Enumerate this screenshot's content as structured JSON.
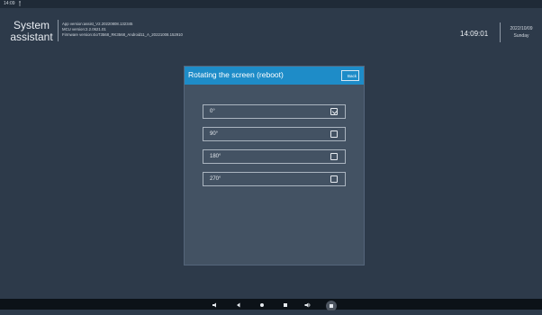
{
  "status_bar": {
    "time": "14:09",
    "signal": "⁈"
  },
  "header": {
    "app_title_line1": "System",
    "app_title_line2": "assistant",
    "app_version": "App version:assist_V2.20220808.132345",
    "mcu_version": "MCU version:2.2.0621.01",
    "firmware_version": "Firmware version:4ioT3568_RK3568_Android11_A_20221008.152910",
    "clock": "14:09:01",
    "date": "2022/10/09",
    "weekday": "Sunday"
  },
  "dialog": {
    "title": "Rotating the screen (reboot)",
    "back_label": "Back",
    "options": [
      {
        "label": "0°",
        "checked": true
      },
      {
        "label": "90°",
        "checked": false
      },
      {
        "label": "180°",
        "checked": false
      },
      {
        "label": "270°",
        "checked": false
      }
    ]
  },
  "nav_icons": [
    "volume-down-icon",
    "back-icon",
    "home-icon",
    "recents-icon",
    "volume-up-icon",
    "screenshot-icon"
  ],
  "colors": {
    "background": "#2d3a4a",
    "dialog": "#435263",
    "accent": "#1e8cc8"
  }
}
